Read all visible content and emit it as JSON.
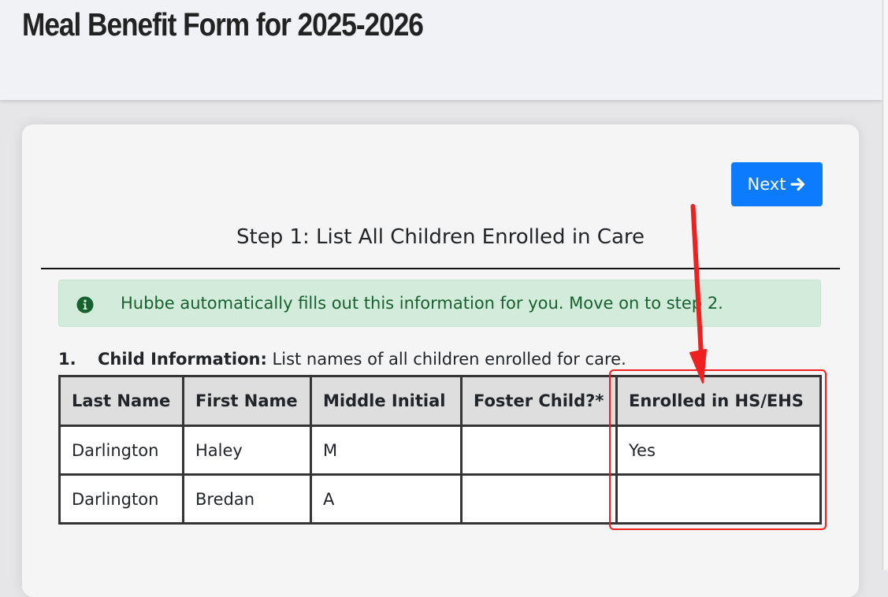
{
  "header": {
    "title": "Meal Benefit Form for 2025-2026"
  },
  "actions": {
    "next_label": "Next"
  },
  "step": {
    "title": "Step 1: List All Children Enrolled in Care"
  },
  "alert": {
    "icon": "info-circle-icon",
    "text": "Hubbe automatically fills out this information for you. Move on to step 2.",
    "color": "#16622e",
    "background": "#d3ebdb"
  },
  "section": {
    "number": "1.",
    "label": "Child Information:",
    "description": "List names of all children enrolled for care."
  },
  "table": {
    "columns": [
      "Last Name",
      "First Name",
      "Middle Initial",
      "Foster Child?*",
      "Enrolled in HS/EHS"
    ],
    "rows": [
      [
        "Darlington",
        "Haley",
        "M",
        "",
        "Yes"
      ],
      [
        "Darlington",
        "Bredan",
        "A",
        "",
        ""
      ]
    ]
  },
  "annotation": {
    "color": "#ef2020",
    "highlighted_column": "Enrolled in HS/EHS"
  },
  "colors": {
    "primary_button": "#0d7bfd",
    "header_bg": "#f1f2f6",
    "card_bg": "#f5f5f5"
  }
}
